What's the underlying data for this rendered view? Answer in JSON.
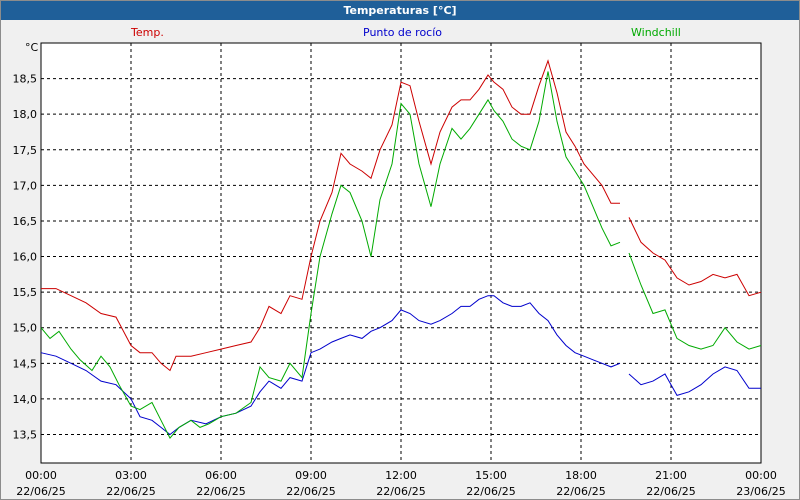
{
  "window": {
    "title": "Temperaturas [°C]"
  },
  "chart_data": {
    "type": "line",
    "title": "Temperaturas [°C]",
    "ylabel": "°C",
    "ylim": [
      13.1,
      19.0
    ],
    "yticks": [
      "13,5",
      "14,0",
      "14,5",
      "15,0",
      "15,5",
      "16,0",
      "16,5",
      "17,0",
      "17,5",
      "18,0",
      "18,5"
    ],
    "ytick_values": [
      13.5,
      14.0,
      14.5,
      15.0,
      15.5,
      16.0,
      16.5,
      17.0,
      17.5,
      18.0,
      18.5
    ],
    "xticks": [
      {
        "time": "00:00",
        "date": "22/06/25",
        "h": 0
      },
      {
        "time": "03:00",
        "date": "22/06/25",
        "h": 3
      },
      {
        "time": "06:00",
        "date": "22/06/25",
        "h": 6
      },
      {
        "time": "09:00",
        "date": "22/06/25",
        "h": 9
      },
      {
        "time": "12:00",
        "date": "22/06/25",
        "h": 12
      },
      {
        "time": "15:00",
        "date": "22/06/25",
        "h": 15
      },
      {
        "time": "18:00",
        "date": "22/06/25",
        "h": 18
      },
      {
        "time": "21:00",
        "date": "22/06/25",
        "h": 21
      },
      {
        "time": "00:00",
        "date": "23/06/25",
        "h": 24
      }
    ],
    "grid": true,
    "series": [
      {
        "name": "Temp.",
        "color": "#cc0000",
        "points": [
          [
            0,
            15.55
          ],
          [
            0.5,
            15.55
          ],
          [
            1,
            15.45
          ],
          [
            1.5,
            15.35
          ],
          [
            2,
            15.2
          ],
          [
            2.5,
            15.15
          ],
          [
            3,
            14.75
          ],
          [
            3.3,
            14.65
          ],
          [
            3.7,
            14.65
          ],
          [
            4,
            14.5
          ],
          [
            4.3,
            14.4
          ],
          [
            4.5,
            14.6
          ],
          [
            5,
            14.6
          ],
          [
            5.5,
            14.65
          ],
          [
            6,
            14.7
          ],
          [
            6.5,
            14.75
          ],
          [
            7,
            14.8
          ],
          [
            7.3,
            15.0
          ],
          [
            7.6,
            15.3
          ],
          [
            8,
            15.2
          ],
          [
            8.3,
            15.45
          ],
          [
            8.7,
            15.4
          ],
          [
            9,
            16.0
          ],
          [
            9.3,
            16.5
          ],
          [
            9.7,
            16.9
          ],
          [
            10,
            17.45
          ],
          [
            10.3,
            17.3
          ],
          [
            10.7,
            17.2
          ],
          [
            11,
            17.1
          ],
          [
            11.3,
            17.5
          ],
          [
            11.7,
            17.85
          ],
          [
            12,
            18.45
          ],
          [
            12.3,
            18.4
          ],
          [
            12.6,
            17.9
          ],
          [
            13,
            17.3
          ],
          [
            13.3,
            17.75
          ],
          [
            13.7,
            18.1
          ],
          [
            14,
            18.2
          ],
          [
            14.3,
            18.2
          ],
          [
            14.6,
            18.35
          ],
          [
            14.9,
            18.55
          ],
          [
            15.1,
            18.45
          ],
          [
            15.4,
            18.35
          ],
          [
            15.7,
            18.1
          ],
          [
            16,
            18.0
          ],
          [
            16.3,
            18.0
          ],
          [
            16.6,
            18.4
          ],
          [
            16.9,
            18.75
          ],
          [
            17.2,
            18.3
          ],
          [
            17.5,
            17.75
          ],
          [
            17.8,
            17.55
          ],
          [
            18.1,
            17.3
          ],
          [
            18.4,
            17.15
          ],
          [
            18.7,
            17.0
          ],
          [
            19,
            16.75
          ],
          [
            19.3,
            16.75
          ],
          [
            19.5,
            null
          ],
          [
            19.6,
            16.55
          ],
          [
            20,
            16.2
          ],
          [
            20.4,
            16.05
          ],
          [
            20.8,
            15.95
          ],
          [
            21.2,
            15.7
          ],
          [
            21.6,
            15.6
          ],
          [
            22,
            15.65
          ],
          [
            22.4,
            15.75
          ],
          [
            22.8,
            15.7
          ],
          [
            23.2,
            15.75
          ],
          [
            23.6,
            15.45
          ],
          [
            24,
            15.5
          ]
        ]
      },
      {
        "name": "Punto de rocío",
        "color": "#0000cc",
        "points": [
          [
            0,
            14.65
          ],
          [
            0.5,
            14.6
          ],
          [
            1,
            14.5
          ],
          [
            1.5,
            14.4
          ],
          [
            2,
            14.25
          ],
          [
            2.5,
            14.2
          ],
          [
            3,
            14.0
          ],
          [
            3.3,
            13.75
          ],
          [
            3.7,
            13.7
          ],
          [
            4,
            13.6
          ],
          [
            4.3,
            13.5
          ],
          [
            4.6,
            13.6
          ],
          [
            5,
            13.7
          ],
          [
            5.5,
            13.65
          ],
          [
            6,
            13.75
          ],
          [
            6.5,
            13.8
          ],
          [
            7,
            13.9
          ],
          [
            7.3,
            14.1
          ],
          [
            7.6,
            14.25
          ],
          [
            8,
            14.15
          ],
          [
            8.3,
            14.3
          ],
          [
            8.7,
            14.25
          ],
          [
            9,
            14.65
          ],
          [
            9.3,
            14.7
          ],
          [
            9.7,
            14.8
          ],
          [
            10,
            14.85
          ],
          [
            10.3,
            14.9
          ],
          [
            10.7,
            14.85
          ],
          [
            11,
            14.95
          ],
          [
            11.3,
            15.0
          ],
          [
            11.7,
            15.1
          ],
          [
            12,
            15.25
          ],
          [
            12.3,
            15.2
          ],
          [
            12.6,
            15.1
          ],
          [
            13,
            15.05
          ],
          [
            13.3,
            15.1
          ],
          [
            13.7,
            15.2
          ],
          [
            14,
            15.3
          ],
          [
            14.3,
            15.3
          ],
          [
            14.6,
            15.4
          ],
          [
            14.9,
            15.45
          ],
          [
            15.1,
            15.45
          ],
          [
            15.4,
            15.35
          ],
          [
            15.7,
            15.3
          ],
          [
            16,
            15.3
          ],
          [
            16.3,
            15.35
          ],
          [
            16.6,
            15.2
          ],
          [
            16.9,
            15.1
          ],
          [
            17.2,
            14.9
          ],
          [
            17.5,
            14.75
          ],
          [
            17.8,
            14.65
          ],
          [
            18.1,
            14.6
          ],
          [
            18.4,
            14.55
          ],
          [
            18.7,
            14.5
          ],
          [
            19,
            14.45
          ],
          [
            19.3,
            14.5
          ],
          [
            19.5,
            null
          ],
          [
            19.6,
            14.35
          ],
          [
            20,
            14.2
          ],
          [
            20.4,
            14.25
          ],
          [
            20.8,
            14.35
          ],
          [
            21.2,
            14.05
          ],
          [
            21.6,
            14.1
          ],
          [
            22,
            14.2
          ],
          [
            22.4,
            14.35
          ],
          [
            22.8,
            14.45
          ],
          [
            23.2,
            14.4
          ],
          [
            23.6,
            14.15
          ],
          [
            24,
            14.15
          ]
        ]
      },
      {
        "name": "Windchill",
        "color": "#00aa00",
        "points": [
          [
            0,
            15.0
          ],
          [
            0.3,
            14.85
          ],
          [
            0.6,
            14.95
          ],
          [
            1,
            14.7
          ],
          [
            1.3,
            14.55
          ],
          [
            1.7,
            14.4
          ],
          [
            2,
            14.6
          ],
          [
            2.3,
            14.45
          ],
          [
            2.6,
            14.2
          ],
          [
            3,
            13.9
          ],
          [
            3.3,
            13.85
          ],
          [
            3.7,
            13.95
          ],
          [
            4,
            13.7
          ],
          [
            4.3,
            13.45
          ],
          [
            4.6,
            13.6
          ],
          [
            5,
            13.7
          ],
          [
            5.3,
            13.6
          ],
          [
            5.6,
            13.65
          ],
          [
            6,
            13.75
          ],
          [
            6.5,
            13.8
          ],
          [
            7,
            13.95
          ],
          [
            7.3,
            14.45
          ],
          [
            7.6,
            14.3
          ],
          [
            8,
            14.25
          ],
          [
            8.3,
            14.5
          ],
          [
            8.7,
            14.3
          ],
          [
            9,
            15.2
          ],
          [
            9.3,
            16.0
          ],
          [
            9.7,
            16.6
          ],
          [
            10,
            17.0
          ],
          [
            10.3,
            16.9
          ],
          [
            10.7,
            16.5
          ],
          [
            11,
            16.0
          ],
          [
            11.3,
            16.8
          ],
          [
            11.7,
            17.3
          ],
          [
            12,
            18.15
          ],
          [
            12.3,
            18.0
          ],
          [
            12.6,
            17.3
          ],
          [
            13,
            16.7
          ],
          [
            13.3,
            17.3
          ],
          [
            13.7,
            17.8
          ],
          [
            14,
            17.65
          ],
          [
            14.3,
            17.8
          ],
          [
            14.6,
            18.0
          ],
          [
            14.9,
            18.2
          ],
          [
            15.1,
            18.05
          ],
          [
            15.4,
            17.9
          ],
          [
            15.7,
            17.65
          ],
          [
            16,
            17.55
          ],
          [
            16.3,
            17.5
          ],
          [
            16.6,
            17.9
          ],
          [
            16.9,
            18.6
          ],
          [
            17.2,
            17.9
          ],
          [
            17.5,
            17.4
          ],
          [
            17.8,
            17.2
          ],
          [
            18.1,
            17.0
          ],
          [
            18.4,
            16.7
          ],
          [
            18.7,
            16.4
          ],
          [
            19,
            16.15
          ],
          [
            19.3,
            16.2
          ],
          [
            19.5,
            null
          ],
          [
            19.6,
            16.05
          ],
          [
            20,
            15.6
          ],
          [
            20.4,
            15.2
          ],
          [
            20.8,
            15.25
          ],
          [
            21.2,
            14.85
          ],
          [
            21.6,
            14.75
          ],
          [
            22,
            14.7
          ],
          [
            22.4,
            14.75
          ],
          [
            22.8,
            15.0
          ],
          [
            23.2,
            14.8
          ],
          [
            23.6,
            14.7
          ],
          [
            24,
            14.75
          ]
        ]
      }
    ]
  }
}
